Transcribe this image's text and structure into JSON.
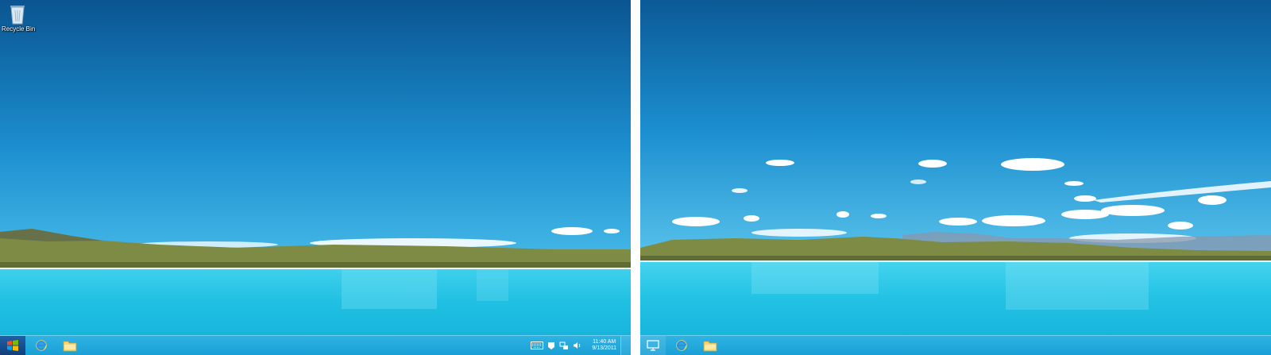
{
  "desktop": {
    "icons": [
      {
        "label": "Recycle Bin",
        "icon": "recycle-bin-icon"
      }
    ]
  },
  "taskbar_left_screen": {
    "start_icon": "windows-logo-icon",
    "pinned": [
      {
        "icon": "internet-explorer-icon"
      },
      {
        "icon": "file-explorer-icon"
      }
    ],
    "tray": {
      "icons": [
        "touch-keyboard-icon",
        "action-center-icon",
        "network-icon",
        "volume-icon"
      ],
      "clock_time": "11:40 AM",
      "clock_date": "9/13/2011"
    }
  },
  "taskbar_right_screen": {
    "start_icon": "desktop-monitor-icon",
    "pinned": [
      {
        "icon": "internet-explorer-icon"
      },
      {
        "icon": "file-explorer-icon"
      }
    ]
  },
  "colors": {
    "sky_top": "#0a5591",
    "sky_horizon": "#3fb6e6",
    "lake": "#21c4e6",
    "hills": "#7d8b44",
    "taskbar": "#22a8dd"
  }
}
